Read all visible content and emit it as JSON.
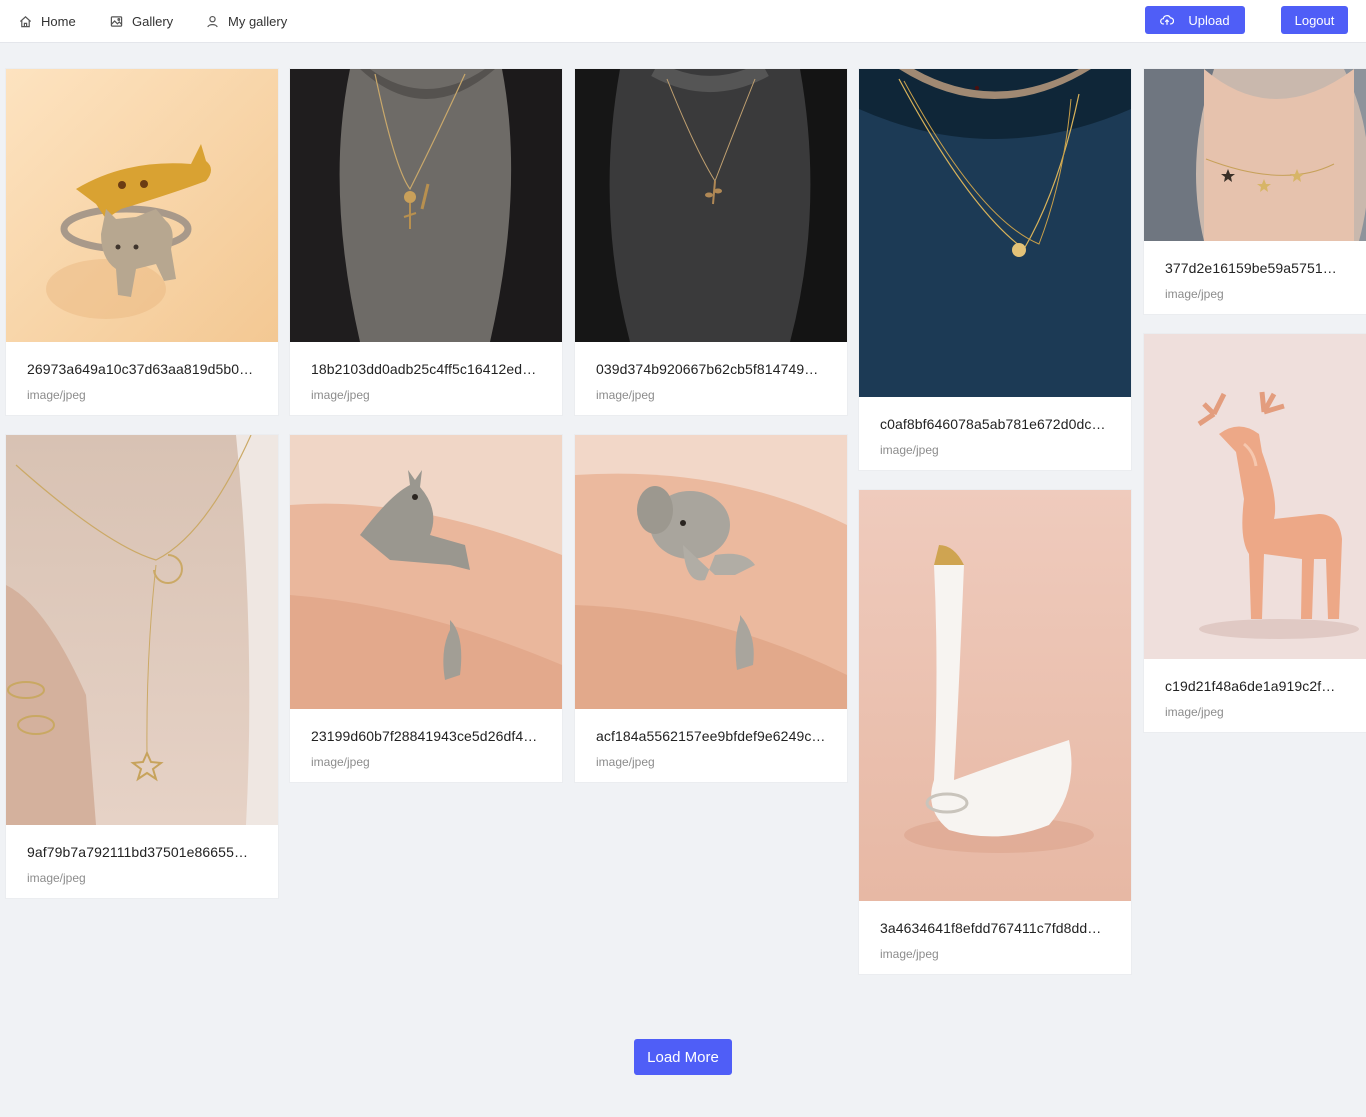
{
  "nav": {
    "home": "Home",
    "gallery": "Gallery",
    "my_gallery": "My gallery",
    "upload": "Upload",
    "logout": "Logout"
  },
  "colors": {
    "accent": "#4f5ef7",
    "background": "#f0f2f5"
  },
  "cards": [
    {
      "name": "26973a649a10c37d63aa819d5b0…",
      "type": "image/jpeg",
      "subject": "gold and silver cat rings"
    },
    {
      "name": "18b2103dd0adb25c4ff5c16412ed…",
      "type": "image/jpeg",
      "subject": "flower pendant necklace on grey sweater"
    },
    {
      "name": "039d374b920667b62cb5f8147498…",
      "type": "image/jpeg",
      "subject": "leaf pendant necklace on dark sweater"
    },
    {
      "name": "c0af8bf646078a5ab781e672d0dc…",
      "type": "image/jpeg",
      "subject": "layered coin and moon necklace on navy sweater"
    },
    {
      "name": "377d2e16159be59a5751…",
      "type": "image/jpeg",
      "subject": "gold star choker necklace"
    },
    {
      "name": "9af79b7a792111bd37501e86655…",
      "type": "image/jpeg",
      "subject": "moon and star lariat necklace"
    },
    {
      "name": "23199d60b7f28841943ce5d26df4…",
      "type": "image/jpeg",
      "subject": "silver giraffe wrap ring"
    },
    {
      "name": "acf184a5562157ee9bfdef9e6249c…",
      "type": "image/jpeg",
      "subject": "silver elephant wrap ring"
    },
    {
      "name": "3a4634641f8efdd767411c7fd8dd…",
      "type": "image/jpeg",
      "subject": "white swan ring holder"
    },
    {
      "name": "c19d21f48a6de1a919c2f…",
      "type": "image/jpeg",
      "subject": "rose gold deer ring holder"
    }
  ],
  "load_more": "Load More"
}
